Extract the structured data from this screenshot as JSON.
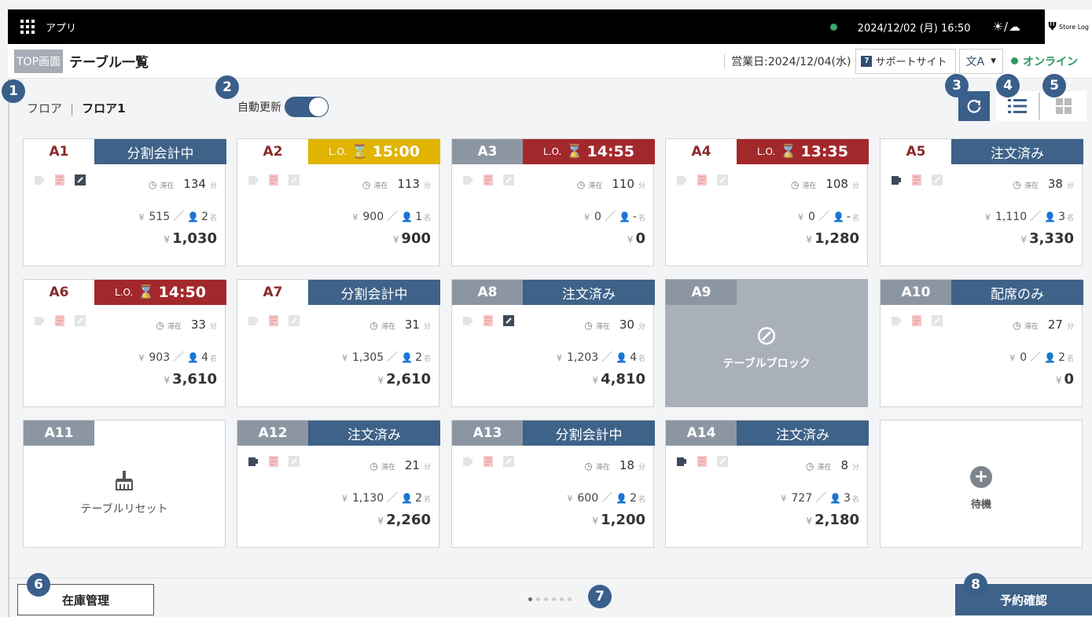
{
  "topbar": {
    "app_label": "アプリ",
    "datetime": "2024/12/02 (月) 16:50",
    "weather": "☀/☁",
    "logo_text": "Store Log"
  },
  "header": {
    "top_button": "TOP画面",
    "title": "テーブル一覧",
    "business_day": "営業日:2024/12/04(水)",
    "support_label": "サポートサイト",
    "lang_label": "文A",
    "online_label": "オンライン"
  },
  "floor": {
    "label": "フロア",
    "separator": "|",
    "name": "フロア1"
  },
  "auto_update": {
    "label": "自動更新",
    "enabled": true
  },
  "markers": [
    "1",
    "2",
    "3",
    "4",
    "5",
    "6",
    "7",
    "8"
  ],
  "common": {
    "lo": "L.O.",
    "stay": "滞在",
    "min_unit": "分",
    "person_unit": "名",
    "yen": "¥",
    "slash": "／"
  },
  "tables": [
    {
      "name": "A1",
      "status": "分割会計中",
      "stay": "134",
      "unit_price": "515",
      "persons": "2",
      "total": "1,030"
    },
    {
      "name": "A2",
      "lo_time": "15:00",
      "stay": "113",
      "unit_price": "900",
      "persons": "1",
      "total": "900"
    },
    {
      "name": "A3",
      "lo_time": "14:55",
      "stay": "110",
      "unit_price": "0",
      "persons": "-",
      "total": "0"
    },
    {
      "name": "A4",
      "lo_time": "13:35",
      "stay": "108",
      "unit_price": "0",
      "persons": "-",
      "total": "1,280"
    },
    {
      "name": "A5",
      "status": "注文済み",
      "stay": "38",
      "unit_price": "1,110",
      "persons": "3",
      "total": "3,330"
    },
    {
      "name": "A6",
      "lo_time": "14:50",
      "stay": "33",
      "unit_price": "903",
      "persons": "4",
      "total": "3,610"
    },
    {
      "name": "A7",
      "status": "分割会計中",
      "stay": "31",
      "unit_price": "1,305",
      "persons": "2",
      "total": "2,610"
    },
    {
      "name": "A8",
      "status": "注文済み",
      "stay": "30",
      "unit_price": "1,203",
      "persons": "4",
      "total": "4,810"
    },
    {
      "name": "A9",
      "block_label": "テーブルブロック"
    },
    {
      "name": "A10",
      "status": "配席のみ",
      "stay": "27",
      "unit_price": "0",
      "persons": "2",
      "total": "0"
    },
    {
      "name": "A11",
      "reset_label": "テーブルリセット"
    },
    {
      "name": "A12",
      "status": "注文済み",
      "stay": "21",
      "unit_price": "1,130",
      "persons": "2",
      "total": "2,260"
    },
    {
      "name": "A13",
      "status": "分割会計中",
      "stay": "18",
      "unit_price": "600",
      "persons": "2",
      "total": "1,200"
    },
    {
      "name": "A14",
      "status": "注文済み",
      "stay": "8",
      "unit_price": "727",
      "persons": "3",
      "total": "2,180"
    }
  ],
  "wait_label": "待機",
  "footer": {
    "stock_button": "在庫管理",
    "reserve_button": "予約確認",
    "page_count": 6,
    "current_page": 1
  },
  "colors": {
    "blue": "#3e6288",
    "yellow": "#e0b400",
    "red": "#a3282c",
    "grey": "#8c96a3",
    "online": "#2d9a5b"
  }
}
